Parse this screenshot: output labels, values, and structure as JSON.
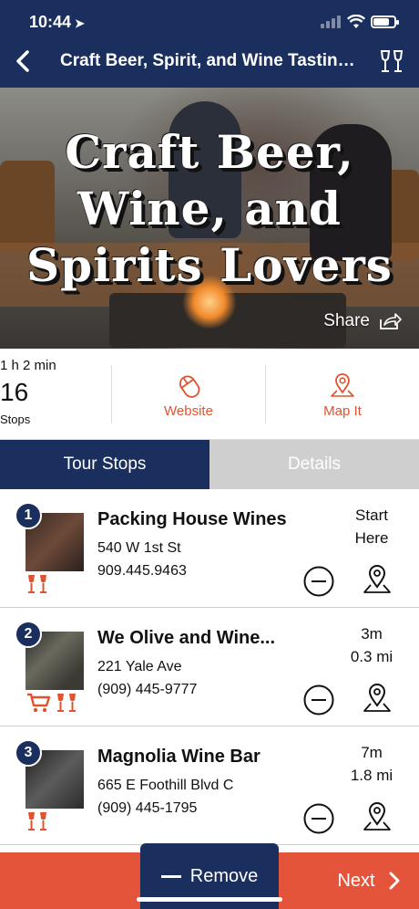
{
  "status_bar": {
    "time": "10:44",
    "location_arrow": "location-arrow-icon"
  },
  "nav": {
    "title": "Craft Beer, Spirit, and Wine Tastin…",
    "back_icon": "chevron-left-icon",
    "right_icon": "wine-glasses-icon"
  },
  "hero": {
    "title_line1": "Craft Beer,",
    "title_line2": "Wine, and",
    "title_line3": "Spirits Lovers",
    "share_label": "Share"
  },
  "stats": {
    "duration": "1 h 2 min",
    "stops_count": "16",
    "stops_label": "Stops",
    "website_label": "Website",
    "map_label": "Map It"
  },
  "tabs": [
    {
      "label": "Tour Stops",
      "active": true
    },
    {
      "label": "Details",
      "active": false
    }
  ],
  "stops": [
    {
      "number": "1",
      "name": "Packing House Wines",
      "address": "540 W 1st St",
      "phone": "909.445.9463",
      "dist_line1": "Start",
      "dist_line2": "Here",
      "categories": [
        "wine-glasses-icon"
      ]
    },
    {
      "number": "2",
      "name": "We Olive and Wine...",
      "address": "221 Yale Ave",
      "phone": "(909) 445-9777",
      "dist_line1": "3m",
      "dist_line2": "0.3 mi",
      "categories": [
        "shopping-cart-icon",
        "wine-glasses-icon"
      ]
    },
    {
      "number": "3",
      "name": "Magnolia Wine Bar",
      "address": "665 E Foothill Blvd C",
      "phone": "(909) 445-1795",
      "dist_line1": "7m",
      "dist_line2": "1.8 mi",
      "categories": [
        "wine-glasses-icon"
      ]
    }
  ],
  "bottom_bar": {
    "remove_label": "Remove",
    "next_label": "Next"
  },
  "colors": {
    "navy": "#1a2f5e",
    "accent": "#e0532f",
    "bottom_bar": "#e4543a"
  }
}
